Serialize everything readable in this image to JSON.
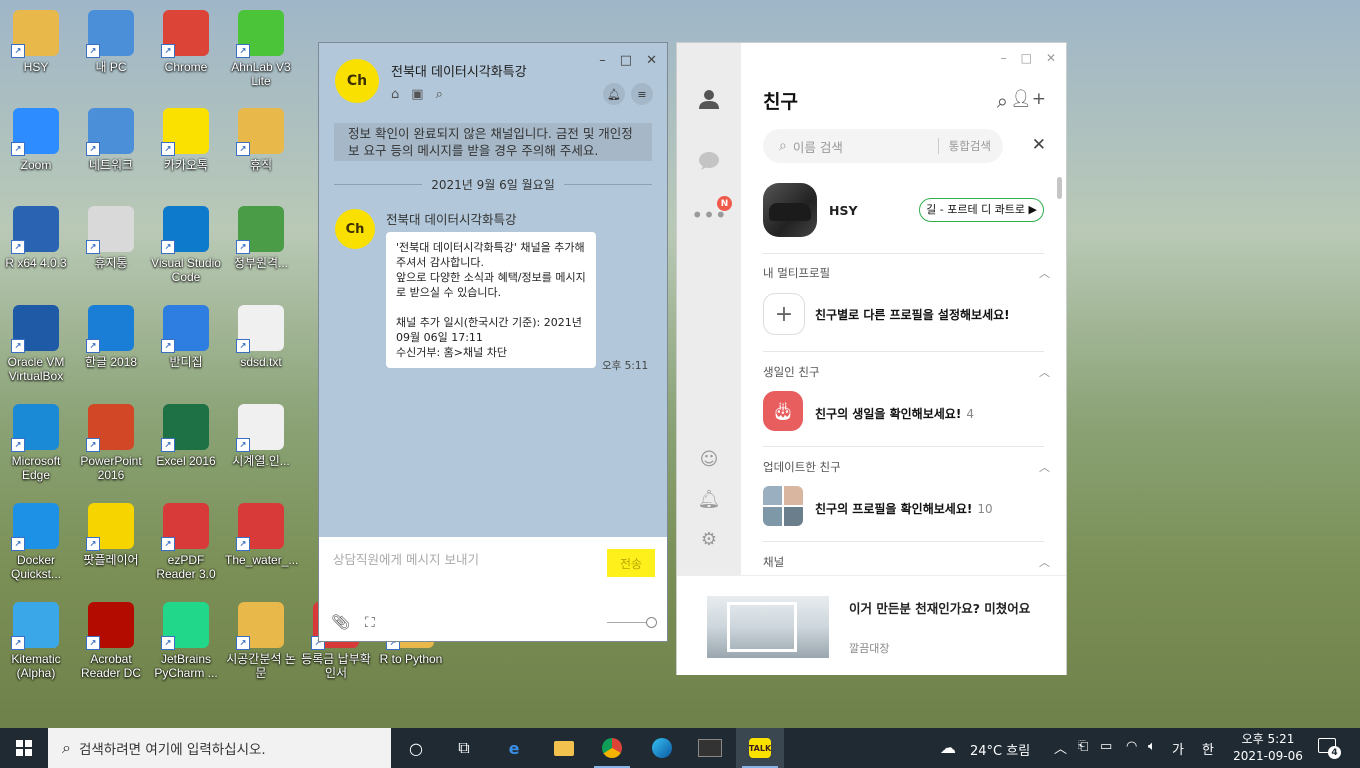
{
  "desktop": {
    "icons": [
      {
        "label": "HSY",
        "icon": "user-folder-icon",
        "color": "#e8b84a"
      },
      {
        "label": "내 PC",
        "icon": "computer-icon",
        "color": "#4a8fd8"
      },
      {
        "label": "Chrome",
        "icon": "chrome-icon",
        "color": "#db4437"
      },
      {
        "label": "AhnLab V3 Lite",
        "icon": "v3-icon",
        "color": "#4cc43a"
      },
      {
        "label": "Zoom",
        "icon": "zoom-icon",
        "color": "#2d8cff"
      },
      {
        "label": "네트워크",
        "icon": "network-icon",
        "color": "#4a8fd8"
      },
      {
        "label": "카카오톡",
        "icon": "kakaotalk-icon",
        "color": "#fae100"
      },
      {
        "label": "휴직",
        "icon": "folder-icon",
        "color": "#e8b84a"
      },
      {
        "label": "R x64 4.0.3",
        "icon": "r-icon",
        "color": "#2b63b3"
      },
      {
        "label": "휴지통",
        "icon": "recycle-bin-icon",
        "color": "#d9d9d9"
      },
      {
        "label": "Visual Studio Code",
        "icon": "vscode-icon",
        "color": "#0e7acc"
      },
      {
        "label": "정부원격...",
        "icon": "remote-icon",
        "color": "#4a9d46"
      },
      {
        "label": "Oracle VM VirtualBox",
        "icon": "virtualbox-icon",
        "color": "#1f5aa6"
      },
      {
        "label": "한글 2018",
        "icon": "hangul-icon",
        "color": "#1a7ed6"
      },
      {
        "label": "반디집",
        "icon": "bandizip-icon",
        "color": "#2d7ee0"
      },
      {
        "label": "sdsd.txt",
        "icon": "text-file-icon",
        "color": "#f0f0f0"
      },
      {
        "label": "Microsoft Edge",
        "icon": "edge-icon",
        "color": "#1a8ad6"
      },
      {
        "label": "PowerPoint 2016",
        "icon": "powerpoint-icon",
        "color": "#d24726"
      },
      {
        "label": "Excel 2016",
        "icon": "excel-icon",
        "color": "#1e7145"
      },
      {
        "label": "시계열.인...",
        "icon": "text-file-icon",
        "color": "#f0f0f0"
      },
      {
        "label": "Docker Quickst...",
        "icon": "docker-icon",
        "color": "#1d91e6"
      },
      {
        "label": "팟플레이어",
        "icon": "potplayer-icon",
        "color": "#f5d400"
      },
      {
        "label": "ezPDF Reader 3.0",
        "icon": "ezpdf-icon",
        "color": "#d83a3a"
      },
      {
        "label": "The_water_...",
        "icon": "pdf-icon",
        "color": "#d83a3a"
      },
      {
        "label": "Kitematic (Alpha)",
        "icon": "kitematic-icon",
        "color": "#3aa8e8"
      },
      {
        "label": "Acrobat Reader DC",
        "icon": "acrobat-icon",
        "color": "#b30b00"
      },
      {
        "label": "JetBrains PyCharm ...",
        "icon": "pycharm-icon",
        "color": "#21d789"
      },
      {
        "label": "시공간분석 논문",
        "icon": "folder-icon",
        "color": "#e8b84a"
      },
      {
        "label": "등록금 납부확인서",
        "icon": "pdf-icon",
        "color": "#d83a3a"
      },
      {
        "label": "R to Python",
        "icon": "folder-icon",
        "color": "#e8b84a"
      }
    ]
  },
  "chat": {
    "title": "전북대 데이터시각화특강",
    "avatar_text": "Ch",
    "notice": "정보 확인이 완료되지 않은 채널입니다. 금전 및 개인정보 요구 등의 메시지를 받을 경우 주의해 주세요.",
    "date": "2021년 9월 6일 월요일",
    "sender": "전북대 데이터시각화특강",
    "message": "'전북대 데이터시각화특강' 채널을 추가해 주셔서 감사합니다.\n앞으로 다양한 소식과 혜택/정보를 메시지로 받으실 수 있습니다.\n\n채널 추가 일시(한국시간 기준): 2021년 09월 06일 17:11\n수신거부: 홈>채널 차단",
    "time": "오후 5:11",
    "input_placeholder": "상담직원에게 메시지 보내기",
    "send_label": "전송"
  },
  "kakao": {
    "title": "친구",
    "search_placeholder": "이름 검색",
    "search_scope": "통합검색",
    "badge": "N",
    "profile": {
      "name": "HSY",
      "music": "길 - 포르테 디 콰트로 ▶"
    },
    "sections": [
      {
        "title": "내 멀티프로필",
        "row": "친구별로 다른 프로필을 설정해보세요!",
        "count": ""
      },
      {
        "title": "생일인 친구",
        "row": "친구의 생일을 확인해보세요!",
        "count": "4"
      },
      {
        "title": "업데이트한 친구",
        "row": "친구의 프로필을 확인해보세요!",
        "count": "10"
      },
      {
        "title": "채널",
        "row": "",
        "count": ""
      }
    ],
    "ad": {
      "title": "이거 만든분 천재인가요? 미쳤어요",
      "source": "깔끔대장"
    }
  },
  "taskbar": {
    "search_placeholder": "검색하려면 여기에 입력하십시오.",
    "weather": "24°C 흐림",
    "ime": "가",
    "ime2": "한",
    "time": "오후 5:21",
    "date": "2021-09-06",
    "notif_count": "4"
  }
}
